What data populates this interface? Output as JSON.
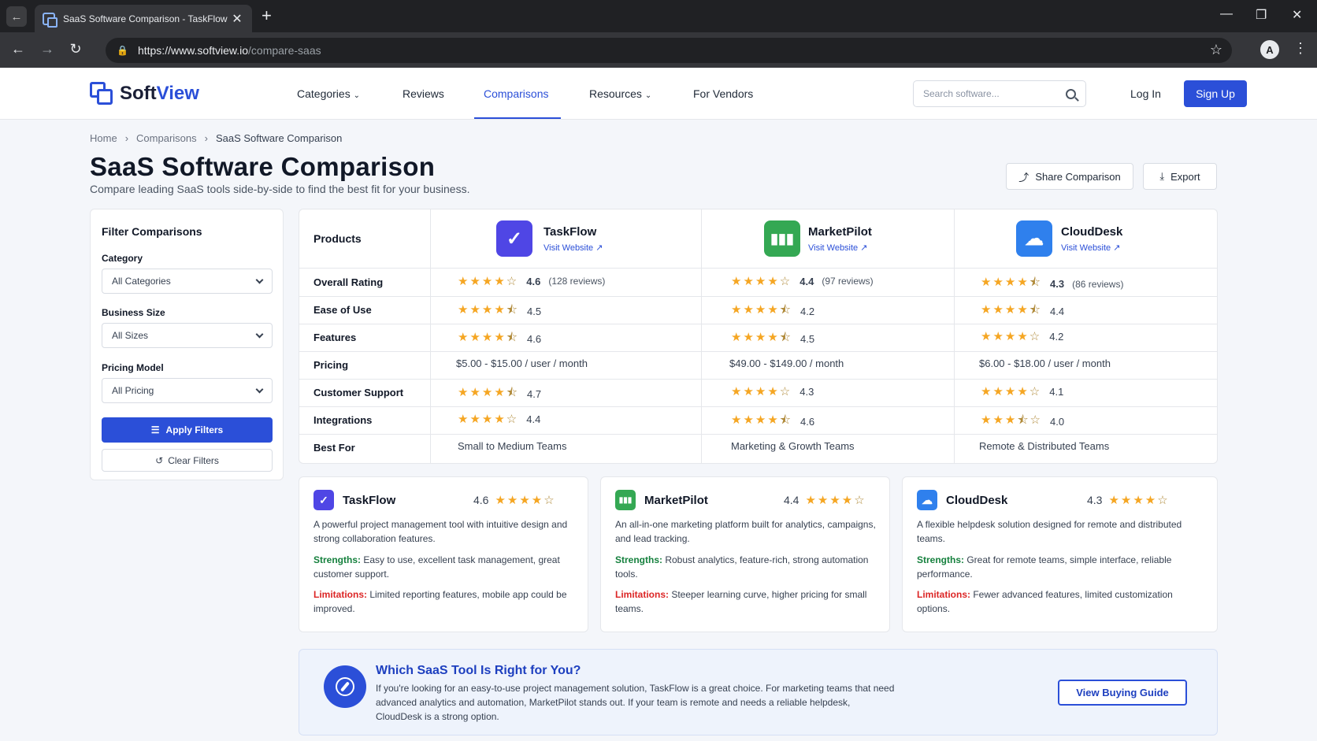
{
  "browser": {
    "tab_title": "SaaS Software Comparison - TaskFlow",
    "url_host": "https://www.softview.io",
    "url_path": "/compare-saas",
    "profile_initial": "A"
  },
  "header": {
    "logo_a": "Soft",
    "logo_b": "View",
    "nav": [
      "Categories",
      "Reviews",
      "Comparisons",
      "Resources",
      "For Vendors"
    ],
    "search_placeholder": "Search software...",
    "login": "Log In",
    "signup": "Sign Up"
  },
  "breadcrumb": [
    "Home",
    "Comparisons",
    "SaaS Software Comparison"
  ],
  "page": {
    "title": "SaaS Software Comparison",
    "subtitle": "Compare leading SaaS tools side-by-side to find the best fit for your business.",
    "share": "Share Comparison",
    "export": "Export"
  },
  "filters": {
    "title": "Filter Comparisons",
    "category_label": "Category",
    "category_value": "All Categories",
    "size_label": "Business Size",
    "size_value": "All Sizes",
    "pricing_label": "Pricing Model",
    "pricing_value": "All Pricing",
    "apply": "Apply Filters",
    "clear": "Clear Filters"
  },
  "table": {
    "head": "Products",
    "visit": "Visit Website",
    "rows": [
      "Overall Rating",
      "Ease of Use",
      "Features",
      "Pricing",
      "Customer Support",
      "Integrations",
      "Best For"
    ],
    "products": [
      {
        "name": "TaskFlow",
        "color": "#4f46e5",
        "overall": "4.6",
        "reviews": "(128 reviews)",
        "ease": "4.5",
        "features": "4.6",
        "pricing": "$5.00 - $15.00 / user / month",
        "support": "4.7",
        "integrations": "4.4",
        "best_for": "Small to Medium Teams"
      },
      {
        "name": "MarketPilot",
        "color": "#34a853",
        "overall": "4.4",
        "reviews": "(97 reviews)",
        "ease": "4.2",
        "features": "4.5",
        "pricing": "$49.00 - $149.00 / month",
        "support": "4.3",
        "integrations": "4.6",
        "best_for": "Marketing & Growth Teams"
      },
      {
        "name": "CloudDesk",
        "color": "#2f80ed",
        "overall": "4.3",
        "reviews": "(86 reviews)",
        "ease": "4.4",
        "features": "4.2",
        "pricing": "$6.00 - $18.00 / user / month",
        "support": "4.1",
        "integrations": "4.0",
        "best_for": "Remote & Distributed Teams"
      }
    ]
  },
  "cards": [
    {
      "name": "TaskFlow",
      "rating": "4.6",
      "desc": "A powerful project management tool with intuitive design and strong collaboration features.",
      "strengths_label": "Strengths:",
      "strengths": "Easy to use, excellent task management, great customer support.",
      "limitations_label": "Limitations:",
      "limitations": "Limited reporting features, mobile app could be improved."
    },
    {
      "name": "MarketPilot",
      "rating": "4.4",
      "desc": "An all-in-one marketing platform built for analytics, campaigns, and lead tracking.",
      "strengths_label": "Strengths:",
      "strengths": "Robust analytics, feature-rich, strong automation tools.",
      "limitations_label": "Limitations:",
      "limitations": "Steeper learning curve, higher pricing for small teams."
    },
    {
      "name": "CloudDesk",
      "rating": "4.3",
      "desc": "A flexible helpdesk solution designed for remote and distributed teams.",
      "strengths_label": "Strengths:",
      "strengths": "Great for remote teams, simple interface, reliable performance.",
      "limitations_label": "Limitations:",
      "limitations": "Fewer advanced features, limited customization options."
    }
  ],
  "guide": {
    "title": "Which SaaS Tool Is Right for You?",
    "text": "If you're looking for an easy-to-use project management solution, TaskFlow is a great choice. For marketing teams that need advanced analytics and automation, MarketPilot stands out. If your team is remote and needs a reliable helpdesk, CloudDesk is a strong option.",
    "button": "View Buying Guide"
  }
}
